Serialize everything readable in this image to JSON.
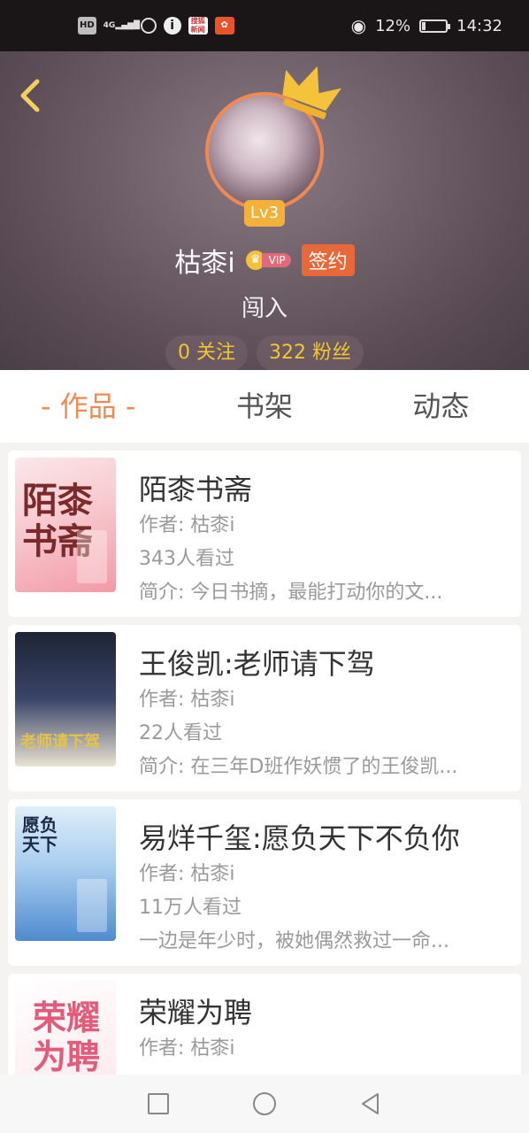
{
  "status_bar": {
    "left_icons": [
      "HD",
      "4G",
      "signal-icon",
      "hotspot-icon",
      "info-icon",
      "app-icon",
      "app-icon"
    ],
    "battery": "12%",
    "battery_level": 0.12,
    "time": "14:32"
  },
  "profile": {
    "level": "Lv3",
    "username": "枯桼i",
    "vip_label": "VIP",
    "signed_label": "签约",
    "signature": "闯入",
    "following": "0 关注",
    "followers": "322 粉丝"
  },
  "tabs": [
    {
      "label": "- 作品 -",
      "active": true
    },
    {
      "label": "书架",
      "active": false
    },
    {
      "label": "动态",
      "active": false
    }
  ],
  "books": [
    {
      "title": "陌桼书斋",
      "author": "作者: 枯桼i",
      "views": "343人看过",
      "summary": "简介: 今日书摘，最能打动你的文...",
      "cover_text": "陌桼书斋"
    },
    {
      "title": "王俊凯:老师请下驾",
      "author": "作者: 枯桼i",
      "views": "22人看过",
      "summary": "简介: 在三年D班作妖惯了的王俊凯...",
      "cover_text": "老师请下驾"
    },
    {
      "title": "易烊千玺:愿负天下不负你",
      "author": "作者: 枯桼i",
      "views": "11万人看过",
      "summary": "一边是年少时，被她偶然救过一命...",
      "cover_text": "愿负天下"
    },
    {
      "title": "荣耀为聘",
      "author": "作者: 枯桼i",
      "views": "",
      "summary": "",
      "cover_text": "荣耀为聘"
    }
  ],
  "colors": {
    "accent": "#f08a52",
    "gold": "#f3c535",
    "level_badge": "#f3b13a"
  }
}
